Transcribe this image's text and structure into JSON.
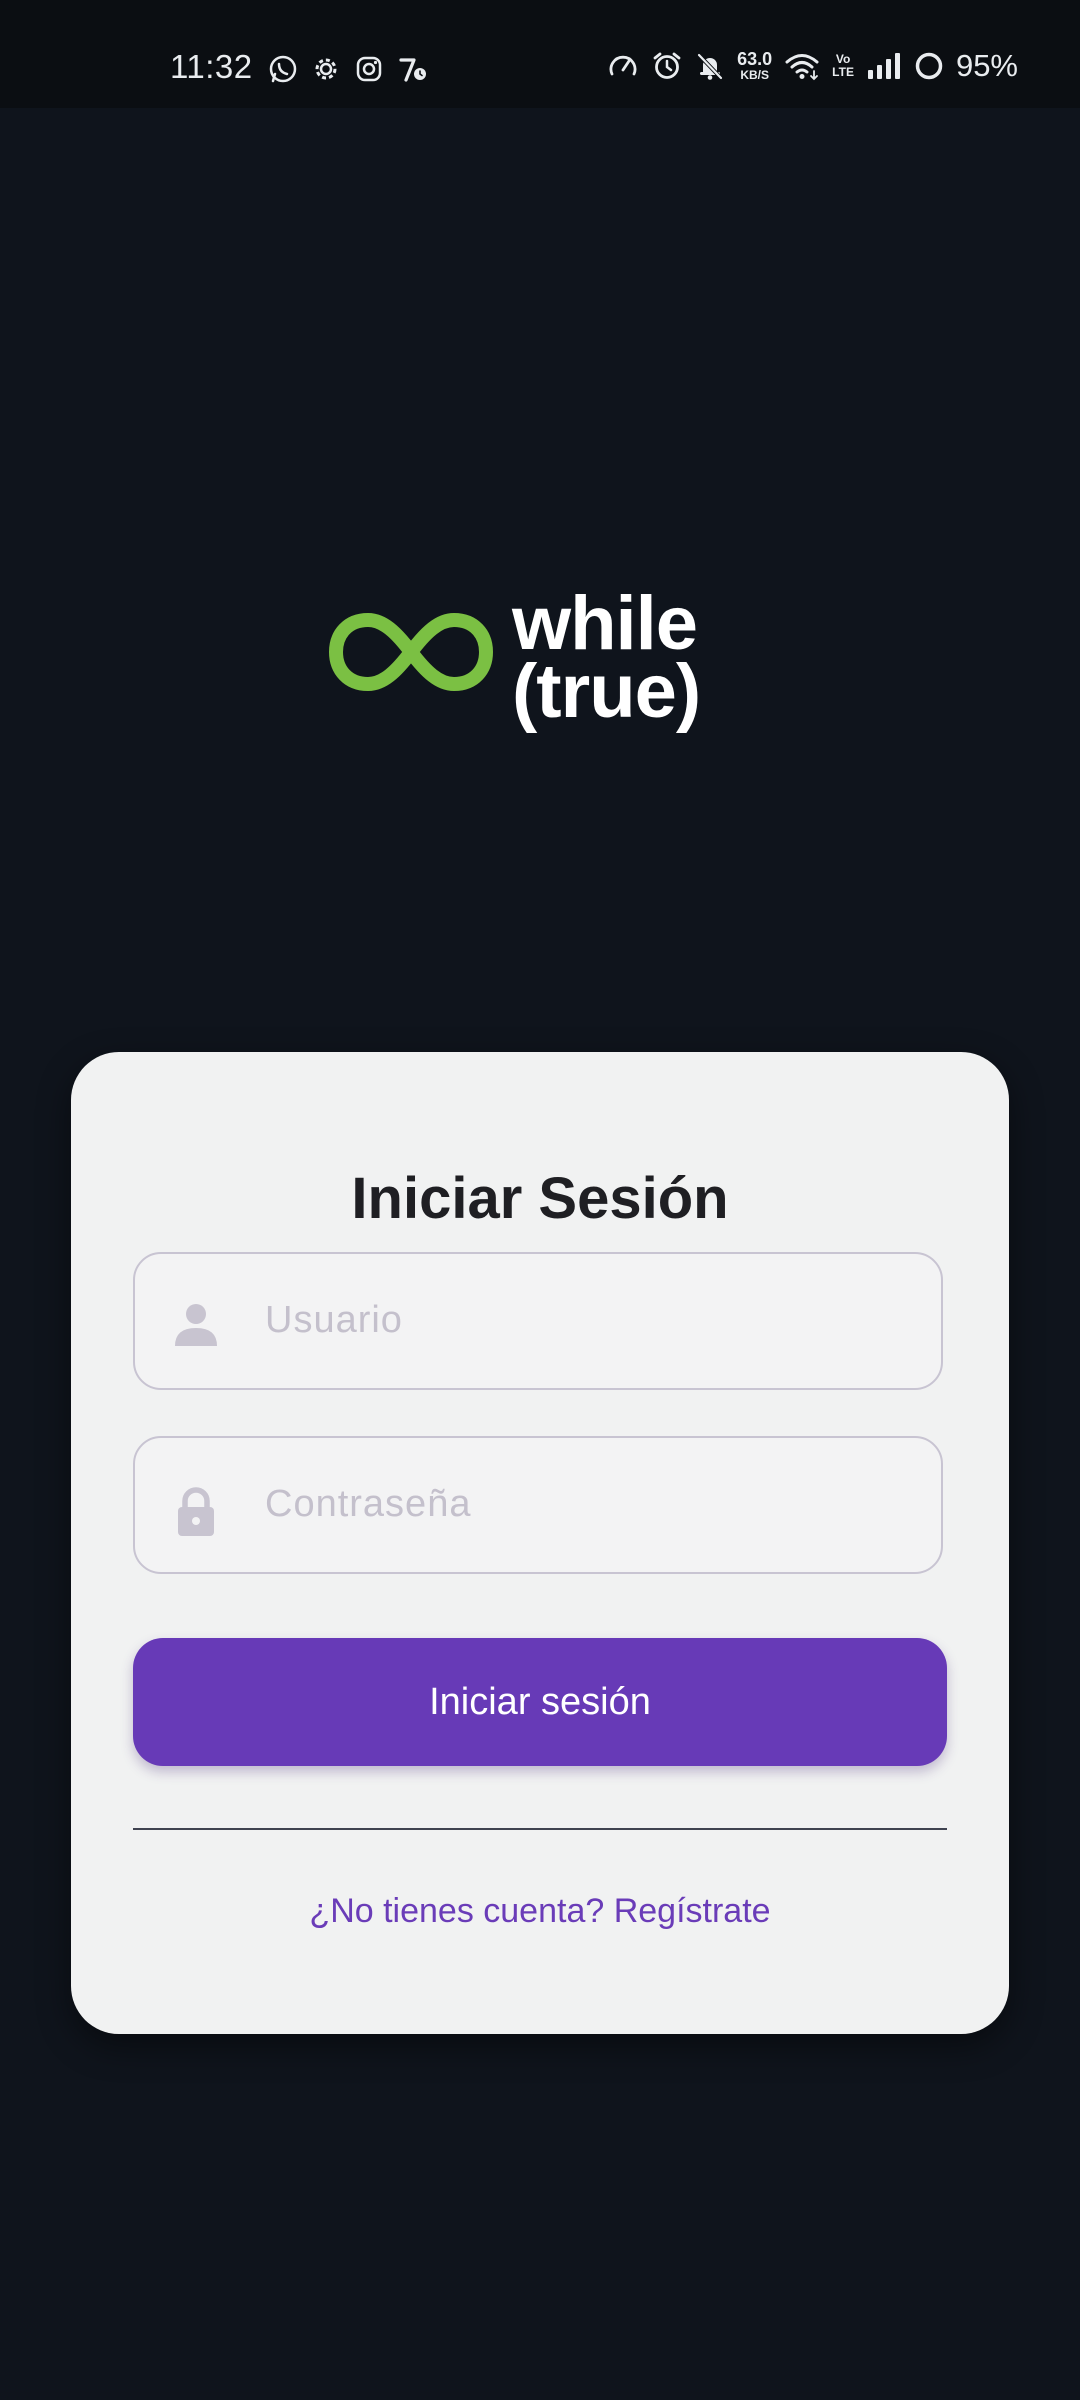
{
  "status_bar": {
    "time": "11:32",
    "left_icons": [
      "whatsapp-icon",
      "settings-gear-icon",
      "instagram-icon",
      "seven-icon"
    ],
    "net_speed_value": "63.0",
    "net_speed_unit": "KB/S",
    "volte_top": "Vo",
    "volte_bottom": "LTE",
    "battery_percent": "95%"
  },
  "logo": {
    "line1": "while",
    "line2": "(true)",
    "accent_color": "#7bc043"
  },
  "login": {
    "title": "Iniciar Sesión",
    "username_placeholder": "Usuario",
    "username_value": "",
    "password_placeholder": "Contraseña",
    "password_value": "",
    "submit_label": "Iniciar sesión",
    "register_link": "¿No tienes cuenta? Regístrate"
  },
  "colors": {
    "background": "#0f141c",
    "card": "#f1f2f2",
    "primary": "#673ab7",
    "link": "#6a3cb8",
    "title": "#1f1f23"
  }
}
